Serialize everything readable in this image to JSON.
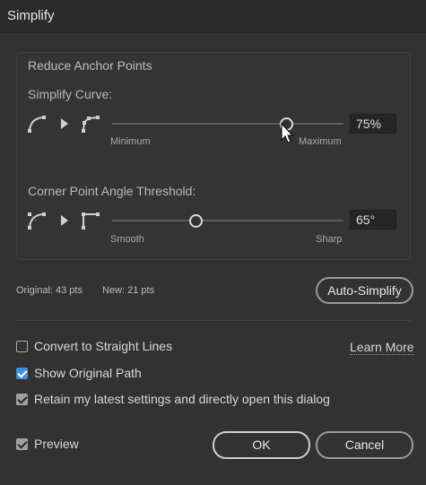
{
  "window": {
    "title": "Simplify"
  },
  "group": {
    "title": "Reduce Anchor Points"
  },
  "curve": {
    "label": "Simplify Curve:",
    "min_label": "Minimum",
    "max_label": "Maximum",
    "value_text": "75%",
    "level": 0.75
  },
  "corner": {
    "label": "Corner Point Angle Threshold:",
    "min_label": "Smooth",
    "max_label": "Sharp",
    "value_text": "65°",
    "level": 0.36
  },
  "stats": {
    "original": "Original: 43 pts",
    "new": "New: 21 pts"
  },
  "buttons": {
    "auto_simplify": "Auto-Simplify",
    "ok": "OK",
    "cancel": "Cancel"
  },
  "options": {
    "straight_lines": {
      "label": "Convert to Straight Lines",
      "checked": false
    },
    "show_original": {
      "label": "Show Original Path",
      "checked": true
    },
    "retain_settings": {
      "label": "Retain my latest settings and directly open this dialog",
      "checked": true
    },
    "preview": {
      "label": "Preview",
      "checked": true
    }
  },
  "learn_more": "Learn More",
  "colors": {
    "background": "#323232",
    "accent": "#3d8ee6"
  }
}
